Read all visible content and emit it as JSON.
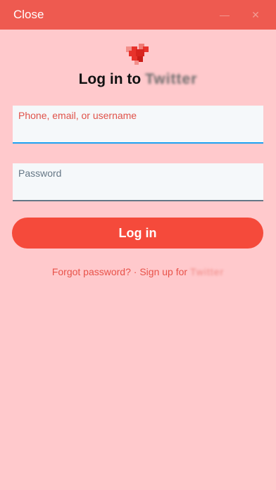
{
  "header": {
    "close_label": "Close",
    "icons": [
      "minus-icon",
      "close-x-icon"
    ]
  },
  "logo": {
    "icon": "heart-logo-icon",
    "color": "#E8322B"
  },
  "heading": {
    "prefix": "Log in to",
    "brand": "Twitter"
  },
  "form": {
    "phone_label": "Phone, email, or username",
    "phone_value": "",
    "password_label": "Password",
    "password_value": ""
  },
  "login_button": {
    "label": "Log in",
    "color": "#F54A3B"
  },
  "links": {
    "forgot": "Forgot password?",
    "separator": "·",
    "signup_prefix": "Sign up for",
    "signup_brand": "Twitter"
  },
  "colors": {
    "background": "#FFC9CC",
    "header": "#EE5A50",
    "accent": "#E8534A",
    "focus_underline": "#1DA1F2"
  }
}
